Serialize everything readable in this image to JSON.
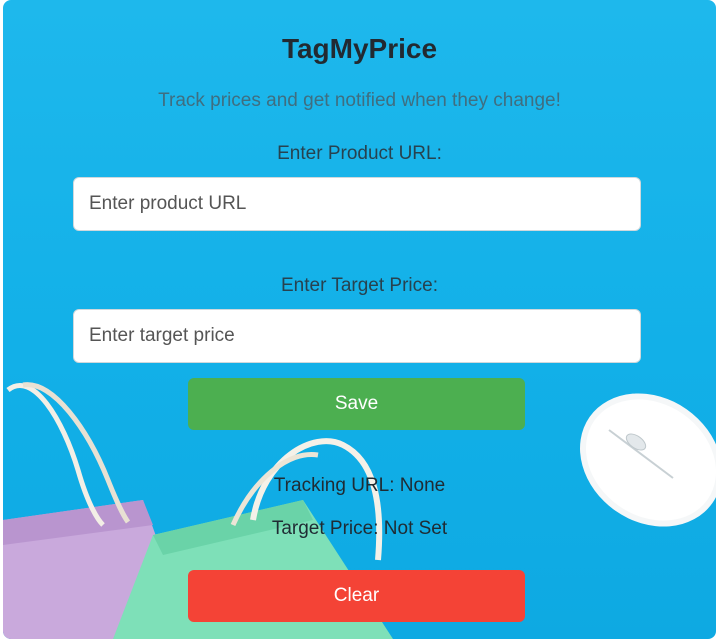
{
  "app": {
    "title": "TagMyPrice",
    "subtitle": "Track prices and get notified when they change!"
  },
  "form": {
    "url_label": "Enter Product URL:",
    "url_placeholder": "Enter product URL",
    "url_value": "",
    "price_label": "Enter Target Price:",
    "price_placeholder": "Enter target price",
    "price_value": "",
    "save_label": "Save"
  },
  "status": {
    "tracking_url": "Tracking URL: None",
    "target_price": "Target Price: Not Set"
  },
  "actions": {
    "clear_label": "Clear"
  },
  "colors": {
    "background": "#12b0e8",
    "save_button": "#4caf50",
    "clear_button": "#f44336",
    "title_text": "#222a31"
  },
  "background_image": {
    "objects": [
      "shopping-bag-purple",
      "shopping-bag-green",
      "computer-mouse"
    ]
  }
}
